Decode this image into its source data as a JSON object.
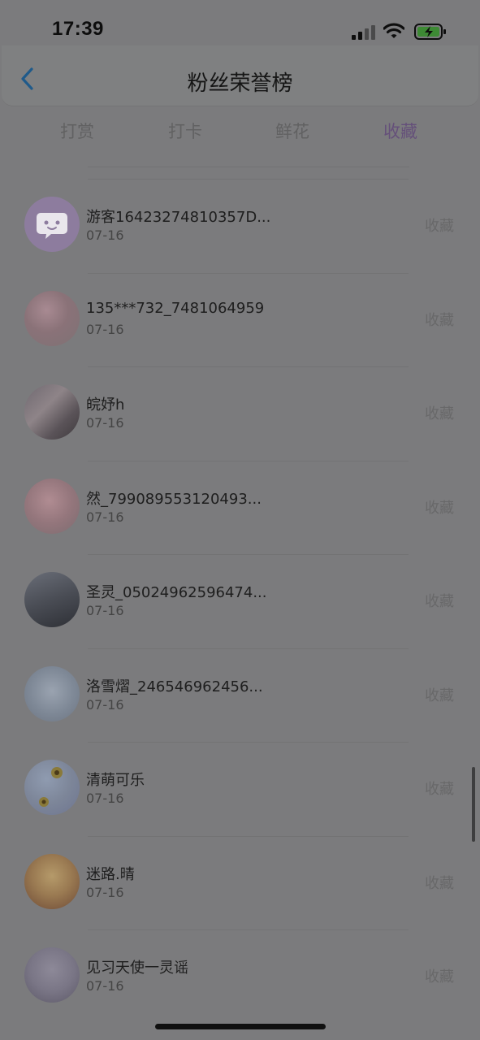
{
  "status_bar": {
    "time": "17:39"
  },
  "header": {
    "title": "粉丝荣誉榜"
  },
  "tabs": [
    {
      "label": "打赏"
    },
    {
      "label": "打卡"
    },
    {
      "label": "鲜花"
    },
    {
      "label": "收藏",
      "active": true
    }
  ],
  "fans": [
    {
      "name": "游客16423274810357D...",
      "date": "07-16",
      "action": "收藏"
    },
    {
      "name": "135***732_7481064959",
      "date": "07-16",
      "action": "收藏"
    },
    {
      "name": "皖妤h",
      "date": "07-16",
      "action": "收藏"
    },
    {
      "name": "然_799089553120493...",
      "date": "07-16",
      "action": "收藏"
    },
    {
      "name": "圣灵_05024962596474...",
      "date": "07-16",
      "action": "收藏"
    },
    {
      "name": "洛雪熠_246546962456...",
      "date": "07-16",
      "action": "收藏"
    },
    {
      "name": "清萌可乐",
      "date": "07-16",
      "action": "收藏"
    },
    {
      "name": "迷路.晴",
      "date": "07-16",
      "action": "收藏"
    },
    {
      "name": "见习天使一灵谣",
      "date": "07-16",
      "action": "收藏"
    }
  ],
  "colors": {
    "overlay_bg": "#7b7b7d",
    "active_tab": "#65507a",
    "battery_charge": "#3d8a34"
  }
}
